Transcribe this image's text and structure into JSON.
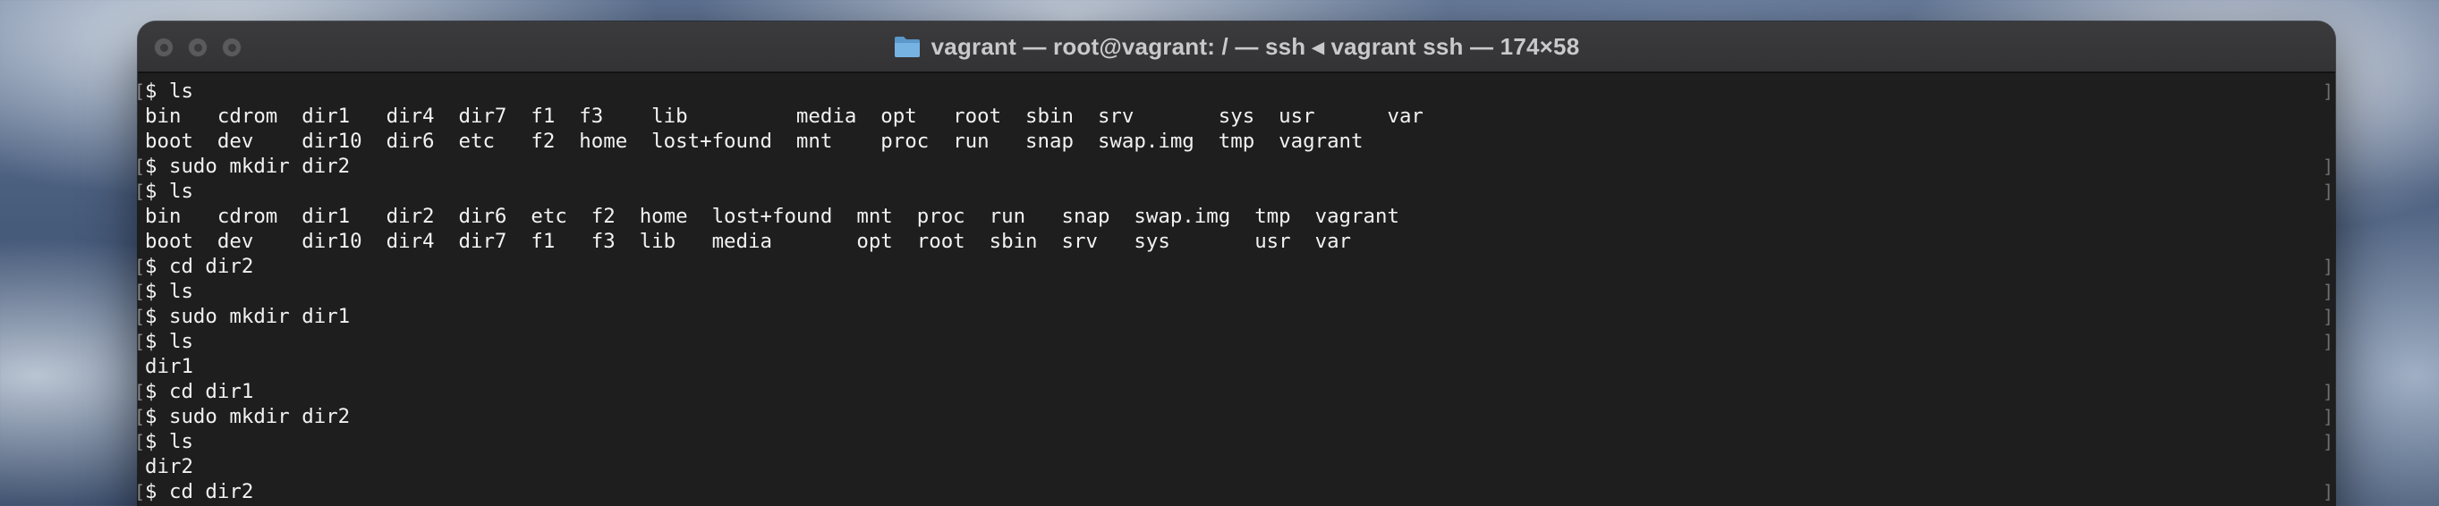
{
  "window": {
    "title": "vagrant — root@vagrant: / — ssh ◂ vagrant ssh — 174×58",
    "title_icon": "folder-icon",
    "traffic_lights": [
      "close",
      "minimize",
      "zoom"
    ]
  },
  "colors": {
    "terminal_bg": "#1e1e1e",
    "terminal_fg": "#f2f2f2",
    "titlebar_bg": "#3b3b3d",
    "folder": "#6aa8d8"
  },
  "terminal": {
    "lines": [
      {
        "text": "$ ls",
        "prompt": true
      },
      {
        "text": "bin   cdrom  dir1   dir4  dir7  f1  f3    lib         media  opt   root  sbin  srv       sys  usr      var",
        "prompt": false
      },
      {
        "text": "boot  dev    dir10  dir6  etc   f2  home  lost+found  mnt    proc  run   snap  swap.img  tmp  vagrant",
        "prompt": false
      },
      {
        "text": "$ sudo mkdir dir2",
        "prompt": true
      },
      {
        "text": "$ ls",
        "prompt": true
      },
      {
        "text": "bin   cdrom  dir1   dir2  dir6  etc  f2  home  lost+found  mnt  proc  run   snap  swap.img  tmp  vagrant",
        "prompt": false
      },
      {
        "text": "boot  dev    dir10  dir4  dir7  f1   f3  lib   media       opt  root  sbin  srv   sys       usr  var",
        "prompt": false
      },
      {
        "text": "$ cd dir2",
        "prompt": true
      },
      {
        "text": "$ ls",
        "prompt": true
      },
      {
        "text": "$ sudo mkdir dir1",
        "prompt": true
      },
      {
        "text": "$ ls",
        "prompt": true
      },
      {
        "text": "dir1",
        "prompt": false
      },
      {
        "text": "$ cd dir1",
        "prompt": true
      },
      {
        "text": "$ sudo mkdir dir2",
        "prompt": true
      },
      {
        "text": "$ ls",
        "prompt": true
      },
      {
        "text": "dir2",
        "prompt": false
      },
      {
        "text": "$ cd dir2",
        "prompt": true
      }
    ]
  }
}
